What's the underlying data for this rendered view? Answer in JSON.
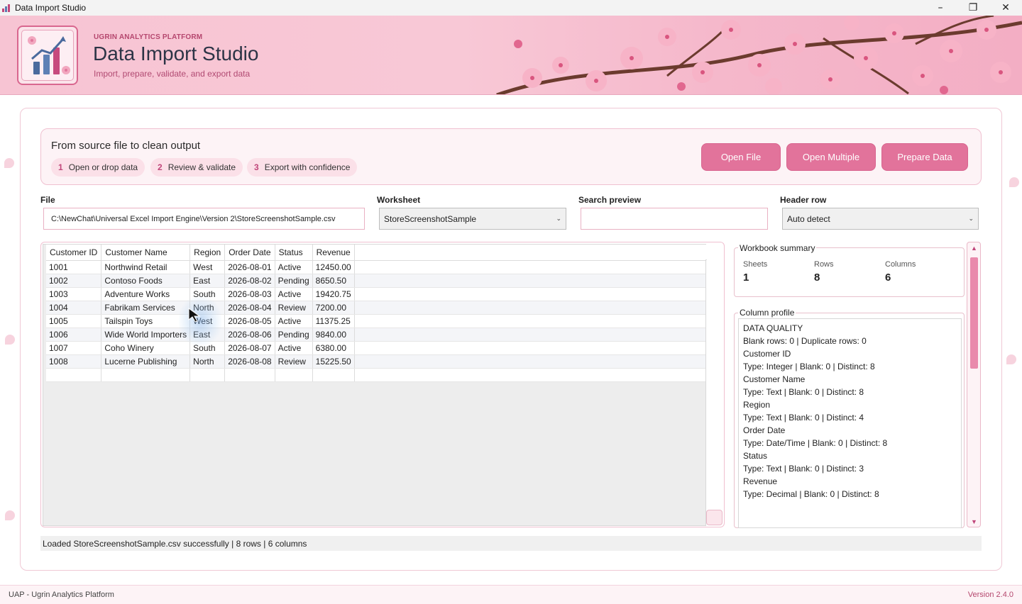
{
  "window": {
    "title": "Data Import Studio"
  },
  "header": {
    "platform": "UGRIN ANALYTICS PLATFORM",
    "title": "Data Import Studio",
    "subtitle": "Import, prepare, validate, and export data"
  },
  "steps": {
    "title": "From source file to clean output",
    "items": [
      {
        "num": "1",
        "label": "Open or drop data"
      },
      {
        "num": "2",
        "label": "Review & validate"
      },
      {
        "num": "3",
        "label": "Export with confidence"
      }
    ]
  },
  "actions": {
    "open_file": "Open File",
    "open_multiple": "Open Multiple",
    "prepare_data": "Prepare Data"
  },
  "fields": {
    "file_label": "File",
    "file_value": "C:\\NewChat\\Universal Excel Import Engine\\Version 2\\StoreScreenshotSample.csv",
    "worksheet_label": "Worksheet",
    "worksheet_value": "StoreScreenshotSample",
    "search_label": "Search preview",
    "search_value": "",
    "header_label": "Header row",
    "header_value": "Auto detect"
  },
  "table": {
    "columns": [
      "Customer ID",
      "Customer Name",
      "Region",
      "Order Date",
      "Status",
      "Revenue"
    ],
    "rows": [
      [
        "1001",
        "Northwind Retail",
        "West",
        "2026-08-01",
        "Active",
        "12450.00"
      ],
      [
        "1002",
        "Contoso Foods",
        "East",
        "2026-08-02",
        "Pending",
        "8650.50"
      ],
      [
        "1003",
        "Adventure Works",
        "South",
        "2026-08-03",
        "Active",
        "19420.75"
      ],
      [
        "1004",
        "Fabrikam Services",
        "North",
        "2026-08-04",
        "Review",
        "7200.00"
      ],
      [
        "1005",
        "Tailspin Toys",
        "West",
        "2026-08-05",
        "Active",
        "11375.25"
      ],
      [
        "1006",
        "Wide World Importers",
        "East",
        "2026-08-06",
        "Pending",
        "9840.00"
      ],
      [
        "1007",
        "Coho Winery",
        "South",
        "2026-08-07",
        "Active",
        "6380.00"
      ],
      [
        "1008",
        "Lucerne Publishing",
        "North",
        "2026-08-08",
        "Review",
        "15225.50"
      ]
    ]
  },
  "summary": {
    "title": "Workbook summary",
    "sheets_label": "Sheets",
    "sheets_value": "1",
    "rows_label": "Rows",
    "rows_value": "8",
    "columns_label": "Columns",
    "columns_value": "6"
  },
  "profile": {
    "title": "Column profile",
    "lines": [
      "DATA QUALITY",
      "Blank rows: 0 | Duplicate rows: 0",
      "Customer ID",
      "Type: Integer | Blank: 0 | Distinct: 8",
      "Customer Name",
      "Type: Text | Blank: 0 | Distinct: 8",
      "Region",
      "Type: Text | Blank: 0 | Distinct: 4",
      "Order Date",
      "Type: Date/Time | Blank: 0 | Distinct: 8",
      "Status",
      "Type: Text | Blank: 0 | Distinct: 3",
      "Revenue",
      "Type: Decimal | Blank: 0 | Distinct: 8"
    ]
  },
  "status": "Loaded StoreScreenshotSample.csv successfully | 8 rows | 6 columns",
  "footer": {
    "left": "UAP - Ugrin Analytics Platform",
    "right": "Version 2.4.0"
  },
  "colors": {
    "accent": "#e2739b",
    "brand": "#b5476e",
    "banner": "#f7c4d3"
  }
}
